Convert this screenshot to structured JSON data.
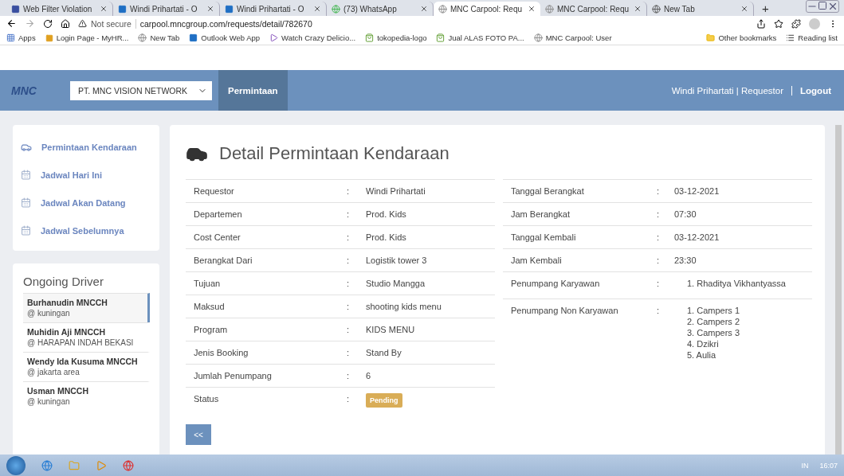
{
  "browser": {
    "tabs": [
      {
        "title": "Web Filter Violation",
        "kind": "m",
        "selected": false
      },
      {
        "title": "Windi Prihartati - O",
        "kind": "outlook",
        "selected": false
      },
      {
        "title": "Windi Prihartati - O",
        "kind": "outlook",
        "selected": false
      },
      {
        "title": "(73) WhatsApp",
        "kind": "whatsapp",
        "selected": false
      },
      {
        "title": "MNC Carpool: Requ",
        "kind": "site",
        "selected": true
      },
      {
        "title": "MNC Carpool: Requ",
        "kind": "site",
        "selected": false
      },
      {
        "title": "New Tab",
        "kind": "globe",
        "selected": false
      }
    ],
    "new_tab": "+",
    "address": {
      "security": "Not secure",
      "url": "carpool.mncgroup.com/requests/detail/782670"
    },
    "bookmarks": [
      {
        "label": "Apps",
        "kind": "apps"
      },
      {
        "label": "Login Page - MyHR...",
        "kind": "diamond"
      },
      {
        "label": "New Tab",
        "kind": "site"
      },
      {
        "label": "Outlook Web App",
        "kind": "outlook"
      },
      {
        "label": "Watch Crazy Delicio...",
        "kind": "play"
      },
      {
        "label": "tokopedia-logo",
        "kind": "bag"
      },
      {
        "label": "Jual ALAS FOTO PA...",
        "kind": "bag"
      },
      {
        "label": "MNC Carpool: User",
        "kind": "site"
      }
    ],
    "other_bookmarks": "Other bookmarks",
    "reading_list": "Reading list"
  },
  "navbar": {
    "logo": "MNC",
    "company": "PT. MNC VISION NETWORK",
    "items": [
      {
        "label": "Permintaan",
        "selected": true
      }
    ],
    "user": "Windi Prihartati | Requestor",
    "logout": "Logout"
  },
  "sidebar": {
    "items": [
      {
        "label": "Permintaan Kendaraan",
        "kind": "car"
      },
      {
        "label": "Jadwal Hari Ini",
        "kind": "calendar"
      },
      {
        "label": "Jadwal Akan Datang",
        "kind": "calendar"
      },
      {
        "label": "Jadwal Sebelumnya",
        "kind": "calendar"
      }
    ]
  },
  "drivers": {
    "title": "Ongoing Driver",
    "items": [
      {
        "name": "Burhanudin MNCCH",
        "location": "@ kuningan",
        "selected": true
      },
      {
        "name": "Muhidin Aji MNCCH",
        "location": "@ HARAPAN INDAH BEKASI",
        "selected": false
      },
      {
        "name": "Wendy Ida Kusuma MNCCH",
        "location": "@ jakarta area",
        "selected": false
      },
      {
        "name": "Usman MNCCH",
        "location": "@ kuningan",
        "selected": false
      }
    ]
  },
  "detail": {
    "title": "Detail Permintaan Kendaraan",
    "separator": ":",
    "left_rows": [
      {
        "label": "Requestor",
        "value": "Windi Prihartati",
        "kind": "text"
      },
      {
        "label": "Departemen",
        "value": "Prod. Kids",
        "kind": "text"
      },
      {
        "label": "Cost Center",
        "value": "Prod. Kids",
        "kind": "text"
      },
      {
        "label": "Berangkat Dari",
        "value": "Logistik tower 3",
        "kind": "text"
      },
      {
        "label": "Tujuan",
        "value": "Studio Mangga",
        "kind": "text"
      },
      {
        "label": "Maksud",
        "value": "shooting kids menu",
        "kind": "text"
      },
      {
        "label": "Program",
        "value": "KIDS MENU",
        "kind": "text"
      },
      {
        "label": "Jenis Booking",
        "value": "Stand By",
        "kind": "text"
      },
      {
        "label": "Jumlah Penumpang",
        "value": "6",
        "kind": "text"
      },
      {
        "label": "Status",
        "value": "Pending",
        "kind": "badge"
      }
    ],
    "right_rows": [
      {
        "label": "Tanggal Berangkat",
        "values": [
          "03-12-2021"
        ],
        "kind": "text"
      },
      {
        "label": "Jam Berangkat",
        "values": [
          "07:30"
        ],
        "kind": "text"
      },
      {
        "label": "Tanggal Kembali",
        "values": [
          "03-12-2021"
        ],
        "kind": "text"
      },
      {
        "label": "Jam Kembali",
        "values": [
          "23:30"
        ],
        "kind": "text"
      },
      {
        "label": "Penumpang Karyawan",
        "values": [
          "1. Rhaditya Vikhantyassa"
        ],
        "kind": "list"
      },
      {
        "label": "Penumpang Non Karyawan",
        "values": [
          "1. Campers 1",
          "2. Campers 2",
          "3. Campers 3",
          "4. Dzikri",
          "5. Aulia"
        ],
        "kind": "list"
      }
    ],
    "back_button": "<<"
  },
  "taskbar": {
    "language": "IN",
    "time": "16:07"
  }
}
